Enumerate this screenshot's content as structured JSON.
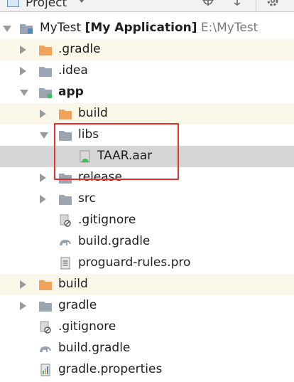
{
  "toolbar": {
    "title": "Project",
    "icons": [
      "project-view-icon",
      "dropdown-caret-icon",
      "locate-target-icon",
      "collapse-all-icon",
      "gear-icon"
    ]
  },
  "tree": {
    "root": {
      "name": "MyTest",
      "module": "[My Application]",
      "path": "E:\\MyTest"
    },
    "items": [
      {
        "label": ".gradle",
        "icon": "folder-orange-icon"
      },
      {
        "label": ".idea",
        "icon": "folder-gray-icon"
      },
      {
        "label": "app",
        "icon": "module-folder-icon"
      },
      {
        "label": "build",
        "icon": "folder-orange-icon"
      },
      {
        "label": "libs",
        "icon": "folder-gray-icon"
      },
      {
        "label": "TAAR.aar",
        "icon": "aar-file-icon"
      },
      {
        "label": "release",
        "icon": "folder-gray-icon"
      },
      {
        "label": "src",
        "icon": "folder-gray-icon"
      },
      {
        "label": ".gitignore",
        "icon": "gitignore-file-icon"
      },
      {
        "label": "build.gradle",
        "icon": "gradle-elephant-icon"
      },
      {
        "label": "proguard-rules.pro",
        "icon": "text-file-icon"
      },
      {
        "label": "build",
        "icon": "folder-orange-icon"
      },
      {
        "label": "gradle",
        "icon": "folder-gray-icon"
      },
      {
        "label": ".gitignore",
        "icon": "gitignore-file-icon"
      },
      {
        "label": "build.gradle",
        "icon": "gradle-elephant-icon"
      },
      {
        "label": "gradle.properties",
        "icon": "properties-file-icon"
      }
    ]
  },
  "colors": {
    "highlight_row": "#fbf8e9",
    "selected_row": "#d5d5d5",
    "annotation_box": "#e4302b",
    "folder_orange": "#f0a35c",
    "folder_gray": "#9aa5b1"
  }
}
